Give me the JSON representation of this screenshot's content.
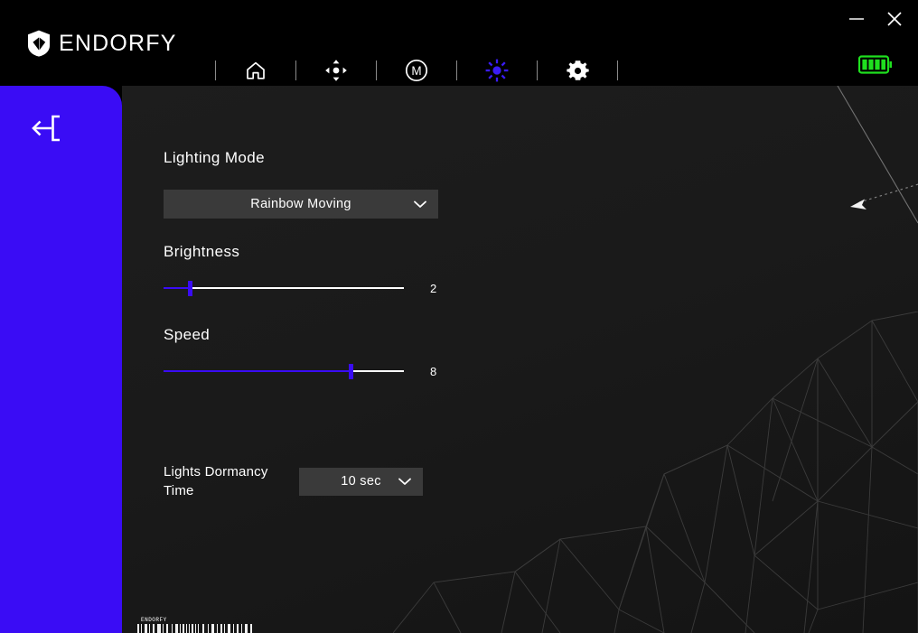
{
  "window": {
    "app_title": "ENDORFY",
    "minimize_label": "—",
    "close_label": "✕"
  },
  "header": {
    "logo_text": "ENDORFY",
    "logo_icon": "endorfy-shield-logo",
    "nav_items": [
      {
        "id": "home",
        "icon": "home-icon",
        "label": "Home",
        "active": false
      },
      {
        "id": "dpi",
        "icon": "dpi-crosshair-icon",
        "label": "DPI",
        "active": false
      },
      {
        "id": "macro",
        "icon": "macro-m-icon",
        "label": "Macro",
        "active": false
      },
      {
        "id": "lighting",
        "icon": "brightness-sun-icon",
        "label": "Lighting",
        "active": true
      },
      {
        "id": "settings",
        "icon": "gear-icon",
        "label": "Settings",
        "active": false
      }
    ],
    "battery": {
      "icon": "battery-full-icon",
      "bars": 4,
      "color": "#1fe01f"
    }
  },
  "sidebar": {
    "back_icon": "back-exit-arrow-icon",
    "color": "#3a0cf5"
  },
  "main": {
    "lighting_mode": {
      "label": "Lighting Mode",
      "selected": "Rainbow Moving",
      "caret_icon": "chevron-down-icon"
    },
    "brightness": {
      "label": "Brightness",
      "value": "2",
      "percent": 11,
      "min": 0,
      "max": 10
    },
    "speed": {
      "label": "Speed",
      "value": "8",
      "percent": 78,
      "min": 0,
      "max": 10
    },
    "dormancy": {
      "label": "Lights Dormancy Time",
      "label_line1": "Lights Dormancy",
      "label_line2": "Time",
      "selected": "10 sec",
      "caret_icon": "chevron-down-icon"
    }
  },
  "decor": {
    "barcode_text": "ENDORFY",
    "accent_color": "#3a0cf5",
    "panel_bg": "#1a1a1a"
  }
}
